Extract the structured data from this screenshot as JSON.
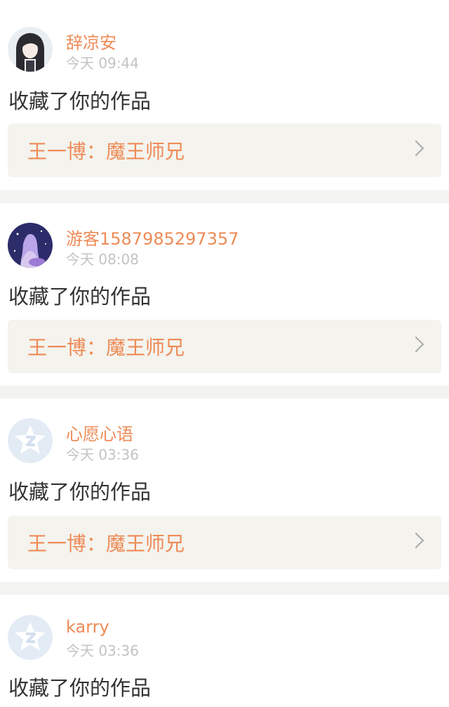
{
  "notifications": [
    {
      "user": "辞凉安",
      "time": "今天 09:44",
      "action": "收藏了你的作品",
      "work": "王一博：魔王师兄",
      "avatar": "anime-girl-dark-hair"
    },
    {
      "user": "游客1587985297357",
      "time": "今天 08:08",
      "action": "收藏了你的作品",
      "work": "王一博：魔王师兄",
      "avatar": "anime-girl-purple-starry"
    },
    {
      "user": "心愿心语",
      "time": "今天 03:36",
      "action": "收藏了你的作品",
      "work": "王一博：魔王师兄",
      "avatar": "default-qzone-star"
    },
    {
      "user": "karry",
      "time": "今天 03:36",
      "action": "收藏了你的作品",
      "avatar": "default-qzone-star"
    }
  ],
  "colors": {
    "accent": "#ee8b57",
    "tab_indicator": "#e8669a",
    "card_bg": "#f4f3ee",
    "separator": "#f3f3f1"
  }
}
